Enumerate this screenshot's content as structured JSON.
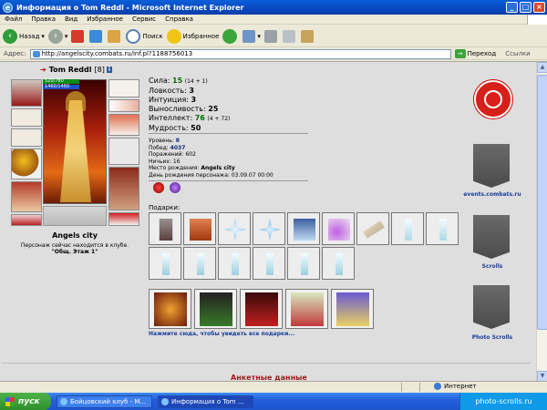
{
  "window": {
    "title": "Информация о Tom Reddl - Microsoft Internet Explorer"
  },
  "menu": [
    "Файл",
    "Правка",
    "Вид",
    "Избранное",
    "Сервис",
    "Справка"
  ],
  "toolbar": {
    "back": "Назад",
    "search": "Поиск",
    "favorites": "Избранное"
  },
  "address": {
    "label": "Адрес:",
    "url": "http://angelscity.combats.ru/inf.pl?1188756013",
    "go": "Переход",
    "links": "Ссылки"
  },
  "character": {
    "name": "Tom Reddl",
    "level": "[8]",
    "info_icon": "i",
    "hp": "520/780",
    "mp": "1460/1460",
    "city": "Angels city",
    "location_note": "Персонаж сейчас находится в клубе.",
    "room": "\"Общ. Этаж 1\""
  },
  "stats": [
    {
      "label": "Сила:",
      "value": "15",
      "bonus": "(14 + 1)",
      "green": true
    },
    {
      "label": "Ловкость:",
      "value": "3",
      "bonus": "",
      "green": false
    },
    {
      "label": "Интуиция:",
      "value": "3",
      "bonus": "",
      "green": false
    },
    {
      "label": "Выносливость:",
      "value": "25",
      "bonus": "",
      "green": false
    },
    {
      "label": "Интеллект:",
      "value": "76",
      "bonus": "(4 + 72)",
      "green": true
    },
    {
      "label": "Мудрость:",
      "value": "50",
      "bonus": "",
      "green": false
    }
  ],
  "info": {
    "level_label": "Уровень:",
    "level_value": "8",
    "wins_label": "Побед:",
    "wins_value": "4037",
    "losses_label": "Поражений:",
    "losses_value": "602",
    "draws_label": "Ничьих:",
    "draws_value": "16",
    "birthplace_label": "Место рождения:",
    "birthplace_value": "Angels city",
    "birthday_label": "День рождения персонажа:",
    "birthday_value": "03.09.07 00:00"
  },
  "gifts": {
    "label": "Подарки:",
    "link": "Нажмите сюда, чтобы увидеть все подарки..."
  },
  "sidebar": {
    "events": "events.combats.ru",
    "scrolls": "Scrolls",
    "photo": "Photo Scrolls"
  },
  "profile_heading": "Анкетные данные",
  "status": {
    "zone": "Интернет"
  },
  "taskbar": {
    "start": "пуск",
    "task1": "Бойцовский клуб - М...",
    "task2": "Информация о Tom ..."
  },
  "watermark": "photo-scrolls.ru",
  "colors": {
    "accent_blue": "#1c3d9c",
    "stat_green": "#007000",
    "heading_red": "#9c1b1b"
  }
}
